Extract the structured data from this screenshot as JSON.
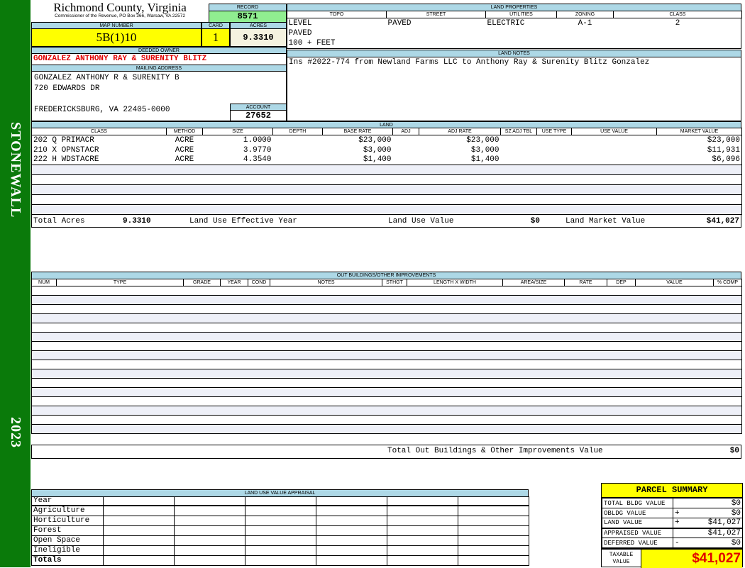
{
  "sidebar": {
    "district": "STONEWALL",
    "year": "2023"
  },
  "header": {
    "county": "Richmond County, Virginia",
    "office": "Commissioner of the Revenue, PO Box 366, Warsaw, VA 22572"
  },
  "record": {
    "label": "RECORD",
    "value": "8571"
  },
  "map": {
    "label": "MAP NUMBER",
    "value": "5B(1)10"
  },
  "card": {
    "label": "CARD",
    "value": "1"
  },
  "acres": {
    "label": "ACRES",
    "value": "9.3310"
  },
  "owner": {
    "label": "DEEDED OWNER",
    "value": "GONZALEZ ANTHONY RAY & SURENITY BLITZ"
  },
  "mailing": {
    "label": "MAILING ADDRESS",
    "lines": [
      "GONZALEZ ANTHONY R & SURENITY B",
      "720 EDWARDS DR",
      "",
      "FREDERICKSBURG, VA 22405-0000"
    ]
  },
  "account": {
    "label": "ACCOUNT",
    "value": "27652"
  },
  "land_properties": {
    "label": "LAND PROPERTIES",
    "columns": [
      "TOPO",
      "STREET",
      "UTILITIES",
      "ZONING",
      "CLASS"
    ],
    "topo": [
      "LEVEL",
      "PAVED",
      "100 + FEET"
    ],
    "street": "PAVED",
    "utilities": "ELECTRIC",
    "zoning": "A-1",
    "class": "2"
  },
  "land_notes": {
    "label": "LAND NOTES",
    "text": "Ins #2022-774 from Newland Farms LLC to Anthony Ray & Surenity Blitz Gonzalez"
  },
  "land": {
    "label": "LAND",
    "columns": [
      "CLASS",
      "METHOD",
      "SIZE",
      "DEPTH",
      "BASE RATE",
      "ADJ",
      "ADJ RATE",
      "SZ ADJ TBL",
      "USE TYPE",
      "USE VALUE",
      "MARKET VALUE"
    ],
    "rows": [
      [
        "202 Q PRIMACR",
        "ACRE",
        "1.0000",
        "",
        "$23,000",
        "",
        "$23,000",
        "",
        "",
        "",
        "$23,000"
      ],
      [
        "210 X OPNSTACR",
        "ACRE",
        "3.9770",
        "",
        "$3,000",
        "",
        "$3,000",
        "",
        "",
        "",
        "$11,931"
      ],
      [
        "222 H WDSTACRE",
        "ACRE",
        "4.3540",
        "",
        "$1,400",
        "",
        "$1,400",
        "",
        "",
        "",
        "$6,096"
      ]
    ],
    "totals": {
      "total_acres_label": "Total Acres",
      "total_acres": "9.3310",
      "effective_year_label": "Land Use Effective Year",
      "use_value_label": "Land Use Value",
      "use_value": "$0",
      "market_value_label": "Land Market Value",
      "market_value": "$41,027"
    }
  },
  "outbuildings": {
    "label": "OUT BUILDINGS/OTHER IMPROVEMENTS",
    "columns": [
      "NUM",
      "TYPE",
      "GRADE",
      "YEAR",
      "COND",
      "NOTES",
      "STHGT",
      "LENGTH X WIDTH",
      "AREA/SIZE",
      "RATE",
      "DEP",
      "VALUE",
      "% COMP"
    ],
    "total_label": "Total Out Buildings & Other Improvements Value",
    "total": "$0"
  },
  "land_use": {
    "label": "LAND USE VALUE APPRAISAL",
    "year_label": "Year",
    "rows": [
      "Agriculture",
      "Horticulture",
      "Forest",
      "Open Space",
      "Ineligible"
    ],
    "totals_label": "Totals"
  },
  "parcel_summary": {
    "title": "PARCEL SUMMARY",
    "rows": [
      {
        "label": "TOTAL BLDG VALUE",
        "sign": "",
        "value": "$0"
      },
      {
        "label": "OBLDG VALUE",
        "sign": "+",
        "value": "$0"
      },
      {
        "label": "LAND VALUE",
        "sign": "+",
        "value": "$41,027"
      },
      {
        "label": "APPRAISED VALUE",
        "sign": "",
        "value": "$41,027"
      },
      {
        "label": "DEFERRED VALUE",
        "sign": "-",
        "value": "$0"
      }
    ],
    "taxable_label": "TAXABLE VALUE",
    "taxable_value": "$41,027"
  },
  "colors": {
    "sidebar": "#0a7a0a",
    "header_bg": "#add8e6",
    "highlight": "#ffff00",
    "record_bg": "#90ee90",
    "owner_text": "#e00000"
  }
}
